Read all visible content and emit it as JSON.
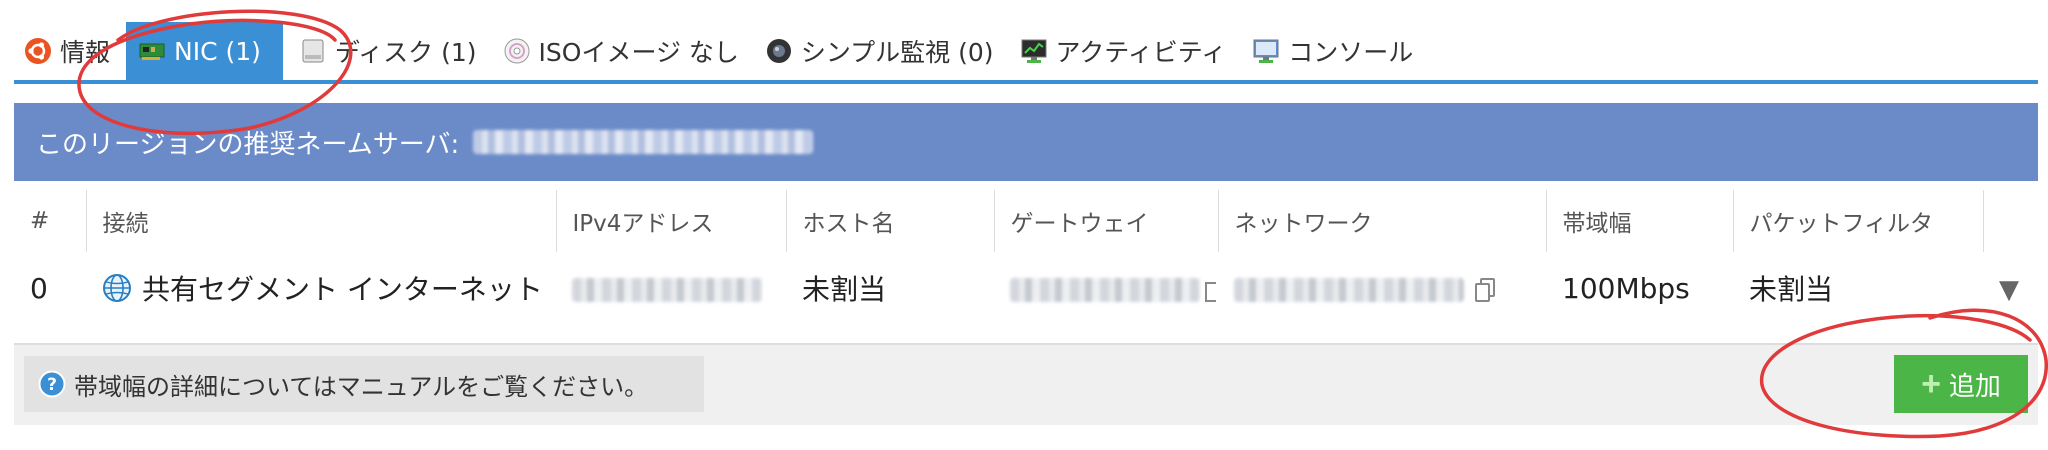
{
  "tabs": [
    {
      "label": "情報",
      "icon": "ubuntu-icon"
    },
    {
      "label": "NIC (1)",
      "icon": "network-card-icon",
      "active": true
    },
    {
      "label": "ディスク (1)",
      "icon": "disk-icon"
    },
    {
      "label": "ISOイメージ なし",
      "icon": "cd-icon"
    },
    {
      "label": "シンプル監視 (0)",
      "icon": "camera-icon"
    },
    {
      "label": "アクティビティ",
      "icon": "monitor-chart-icon"
    },
    {
      "label": "コンソール",
      "icon": "console-icon"
    }
  ],
  "banner": {
    "label": "このリージョンの推奨ネームサーバ:"
  },
  "table": {
    "headers": [
      "#",
      "接続",
      "IPv4アドレス",
      "ホスト名",
      "ゲートウェイ",
      "ネットワーク",
      "帯域幅",
      "パケットフィルタ"
    ],
    "row": {
      "index": "0",
      "connection": "共有セグメント インターネット",
      "hostname": "未割当",
      "bandwidth": "100Mbps",
      "packet_filter": "未割当"
    }
  },
  "footer": {
    "help_text": "帯域幅の詳細についてはマニュアルをご覧ください。",
    "add_label": "追加"
  },
  "colors": {
    "accent": "#3b8fd4",
    "banner": "#6b8bc8",
    "add": "#4cb548",
    "annotation": "#e03a3a"
  }
}
